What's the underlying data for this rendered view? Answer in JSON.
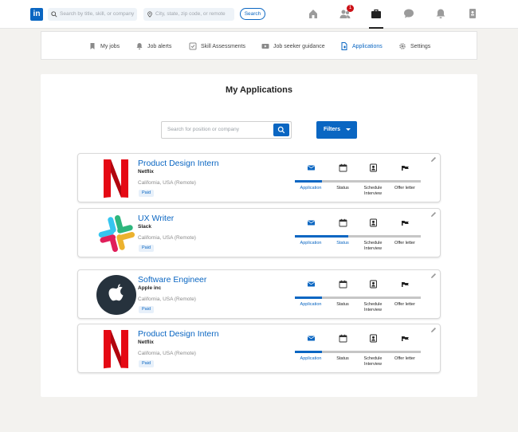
{
  "topbar": {
    "logo": "in",
    "search_placeholder": "Search by title, skill, or company",
    "location_placeholder": "City, state, zip code, or remote",
    "search_button": "Search",
    "notification_count": "1"
  },
  "subnav": {
    "items": [
      {
        "label": "My jobs",
        "icon": "bookmark-icon"
      },
      {
        "label": "Job alerts",
        "icon": "bell-icon"
      },
      {
        "label": "Skill Assessments",
        "icon": "checklist-icon"
      },
      {
        "label": "Job seeker guidance",
        "icon": "video-icon"
      },
      {
        "label": "Applications",
        "icon": "document-icon",
        "active": true
      },
      {
        "label": "Settings",
        "icon": "gear-icon"
      }
    ]
  },
  "panel": {
    "title": "My Applications",
    "search_placeholder": "Search for position or company",
    "filters_label": "Filters"
  },
  "applications": [
    {
      "title": "Product Design Intern",
      "company": "Netflix",
      "location": "California, USA (Remote)",
      "tag": "Paid",
      "logo": "netflix",
      "progress": 1
    },
    {
      "title": "UX Writer",
      "company": "Slack",
      "location": "California, USA (Remote)",
      "tag": "Paid",
      "logo": "slack",
      "progress": 2
    },
    {
      "title": "Software Engineer",
      "company": "Apple inc",
      "location": "California, USA (Remote)",
      "tag": "Paid",
      "logo": "apple",
      "progress": 1
    },
    {
      "title": "Product Design Intern",
      "company": "Netflix",
      "location": "California, USA (Remote)",
      "tag": "Paid",
      "logo": "netflix",
      "progress": 1
    }
  ],
  "steps": [
    "Application",
    "Status",
    "Schedule Interview",
    "Offer letter"
  ],
  "colors": {
    "accent": "#0a66c2",
    "netflix": "#e50914"
  }
}
